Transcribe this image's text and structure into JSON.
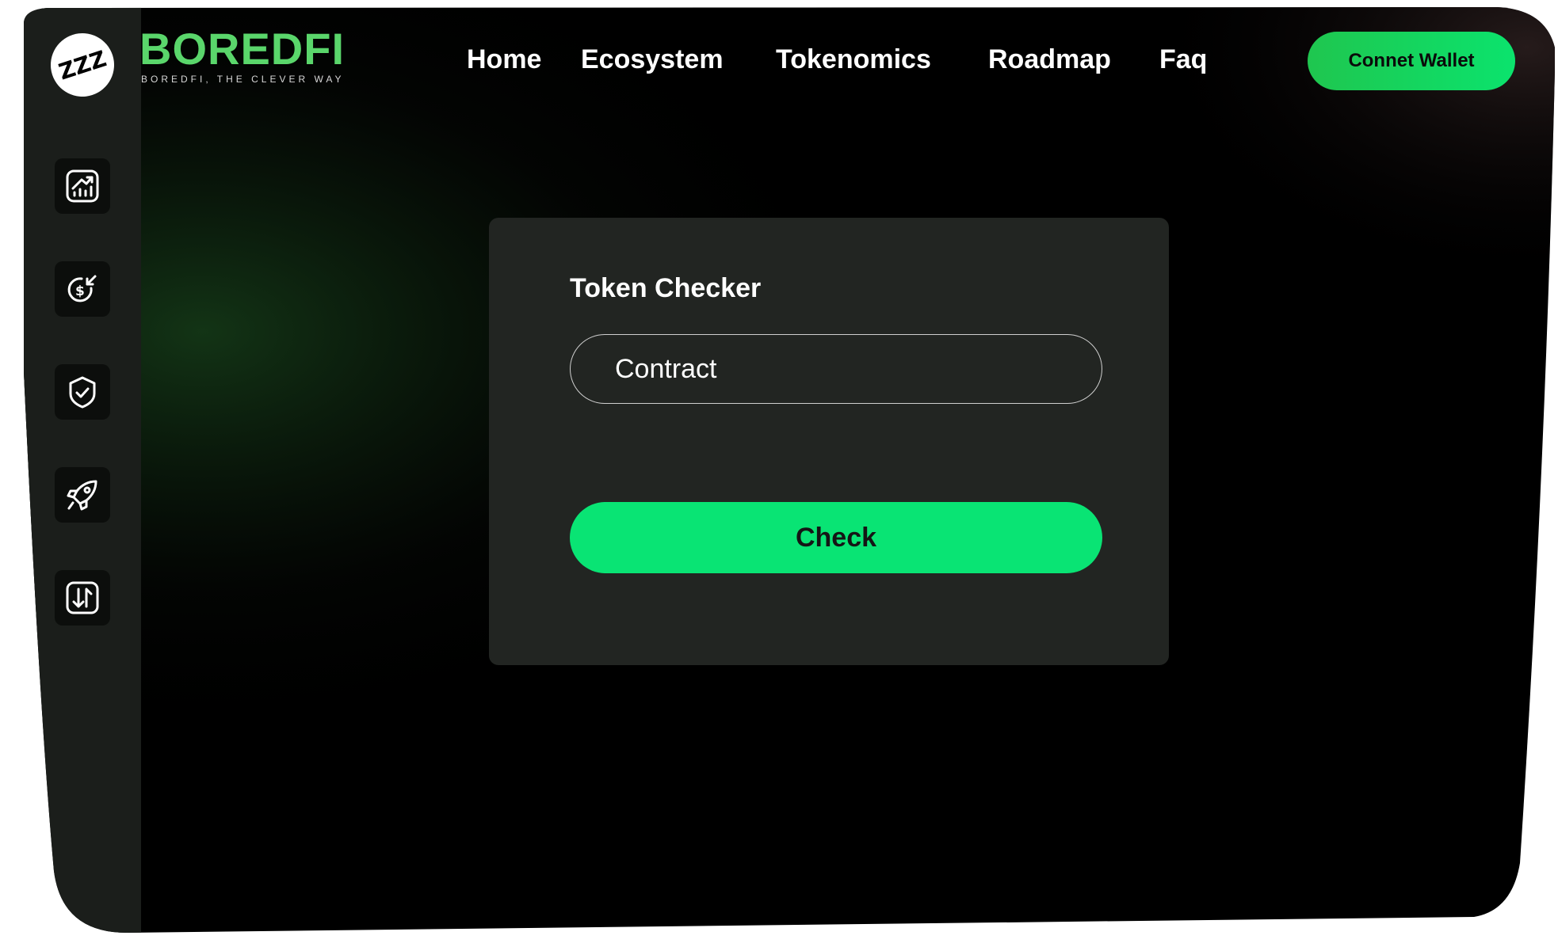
{
  "header": {
    "brand_badge": "ZZZ",
    "brand_name": "BOREDFI",
    "brand_tagline": "BOREDFI, THE CLEVER WAY",
    "nav": [
      {
        "label": "Home"
      },
      {
        "label": "Ecosystem"
      },
      {
        "label": "Tokenomics"
      },
      {
        "label": "Roadmap"
      },
      {
        "label": "Faq"
      }
    ],
    "wallet_button": "Connet Wallet"
  },
  "sidebar": {
    "items": [
      {
        "icon": "chart-growth-icon"
      },
      {
        "icon": "dollar-exchange-icon"
      },
      {
        "icon": "shield-check-icon"
      },
      {
        "icon": "rocket-icon"
      },
      {
        "icon": "swap-arrows-icon"
      }
    ]
  },
  "token_checker": {
    "title": "Token Checker",
    "input_placeholder": "Contract",
    "input_value": "",
    "check_button": "Check"
  },
  "colors": {
    "accent": "#09e474",
    "brand_green": "#5ad66b",
    "card_bg": "#222522",
    "sidebar_bg": "#1b1e1b",
    "page_bg": "#000000"
  }
}
